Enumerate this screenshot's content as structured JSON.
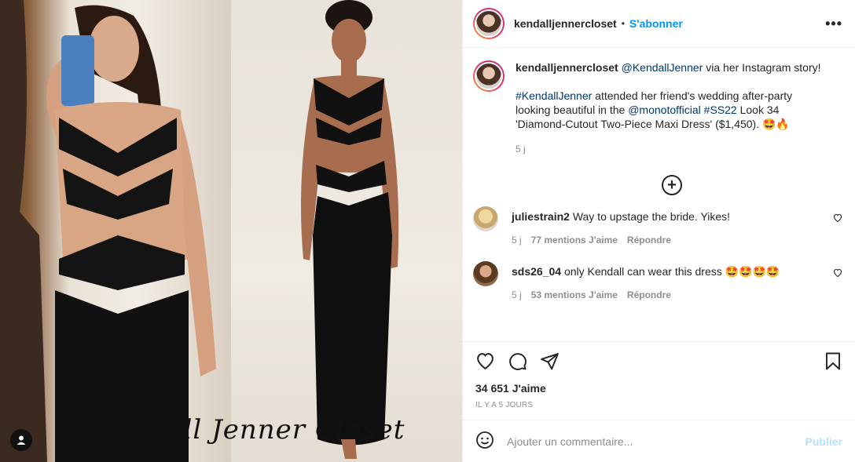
{
  "header": {
    "username": "kendalljennercloset",
    "separator": "•",
    "follow_label": "S'abonner",
    "more_label": "•••"
  },
  "media": {
    "watermark": "Kendall Jenner Closet"
  },
  "caption": {
    "username": "kendalljennercloset",
    "mention": "@KendallJenner",
    "line1_rest": " via her Instagram story!",
    "hashtag1": "#KendallJenner",
    "text2": " attended her friend's wedding after-party looking beautiful in the ",
    "mention2": "@monotofficial",
    "hashtag2": "#SS22",
    "text3": " Look 34 'Diamond-Cutout Two-Piece Maxi Dress' ($1,450). 🤩🔥",
    "time": "5 j"
  },
  "load_more_label": "+",
  "comments": [
    {
      "username": "juliestrain2",
      "text": "Way to upstage the bride. Yikes!",
      "time": "5 j",
      "likes": "77 mentions J'aime",
      "reply": "Répondre"
    },
    {
      "username": "sds26_04",
      "text": "only Kendall can wear this dress 🤩🤩🤩🤩",
      "time": "5 j",
      "likes": "53 mentions J'aime",
      "reply": "Répondre"
    }
  ],
  "stats": {
    "likes": "34 651 J'aime",
    "time_ago": "IL Y A 5 JOURS"
  },
  "composer": {
    "placeholder": "Ajouter un commentaire...",
    "post_label": "Publier"
  },
  "colors": {
    "accent": "#0095f6",
    "link": "#00376b",
    "muted": "#8e8e8e",
    "post_disabled": "#b2dffc"
  },
  "icons": [
    "heart-icon",
    "comment-icon",
    "share-icon",
    "bookmark-icon",
    "emoji-icon",
    "plus-circle-icon",
    "user-tag-icon"
  ]
}
